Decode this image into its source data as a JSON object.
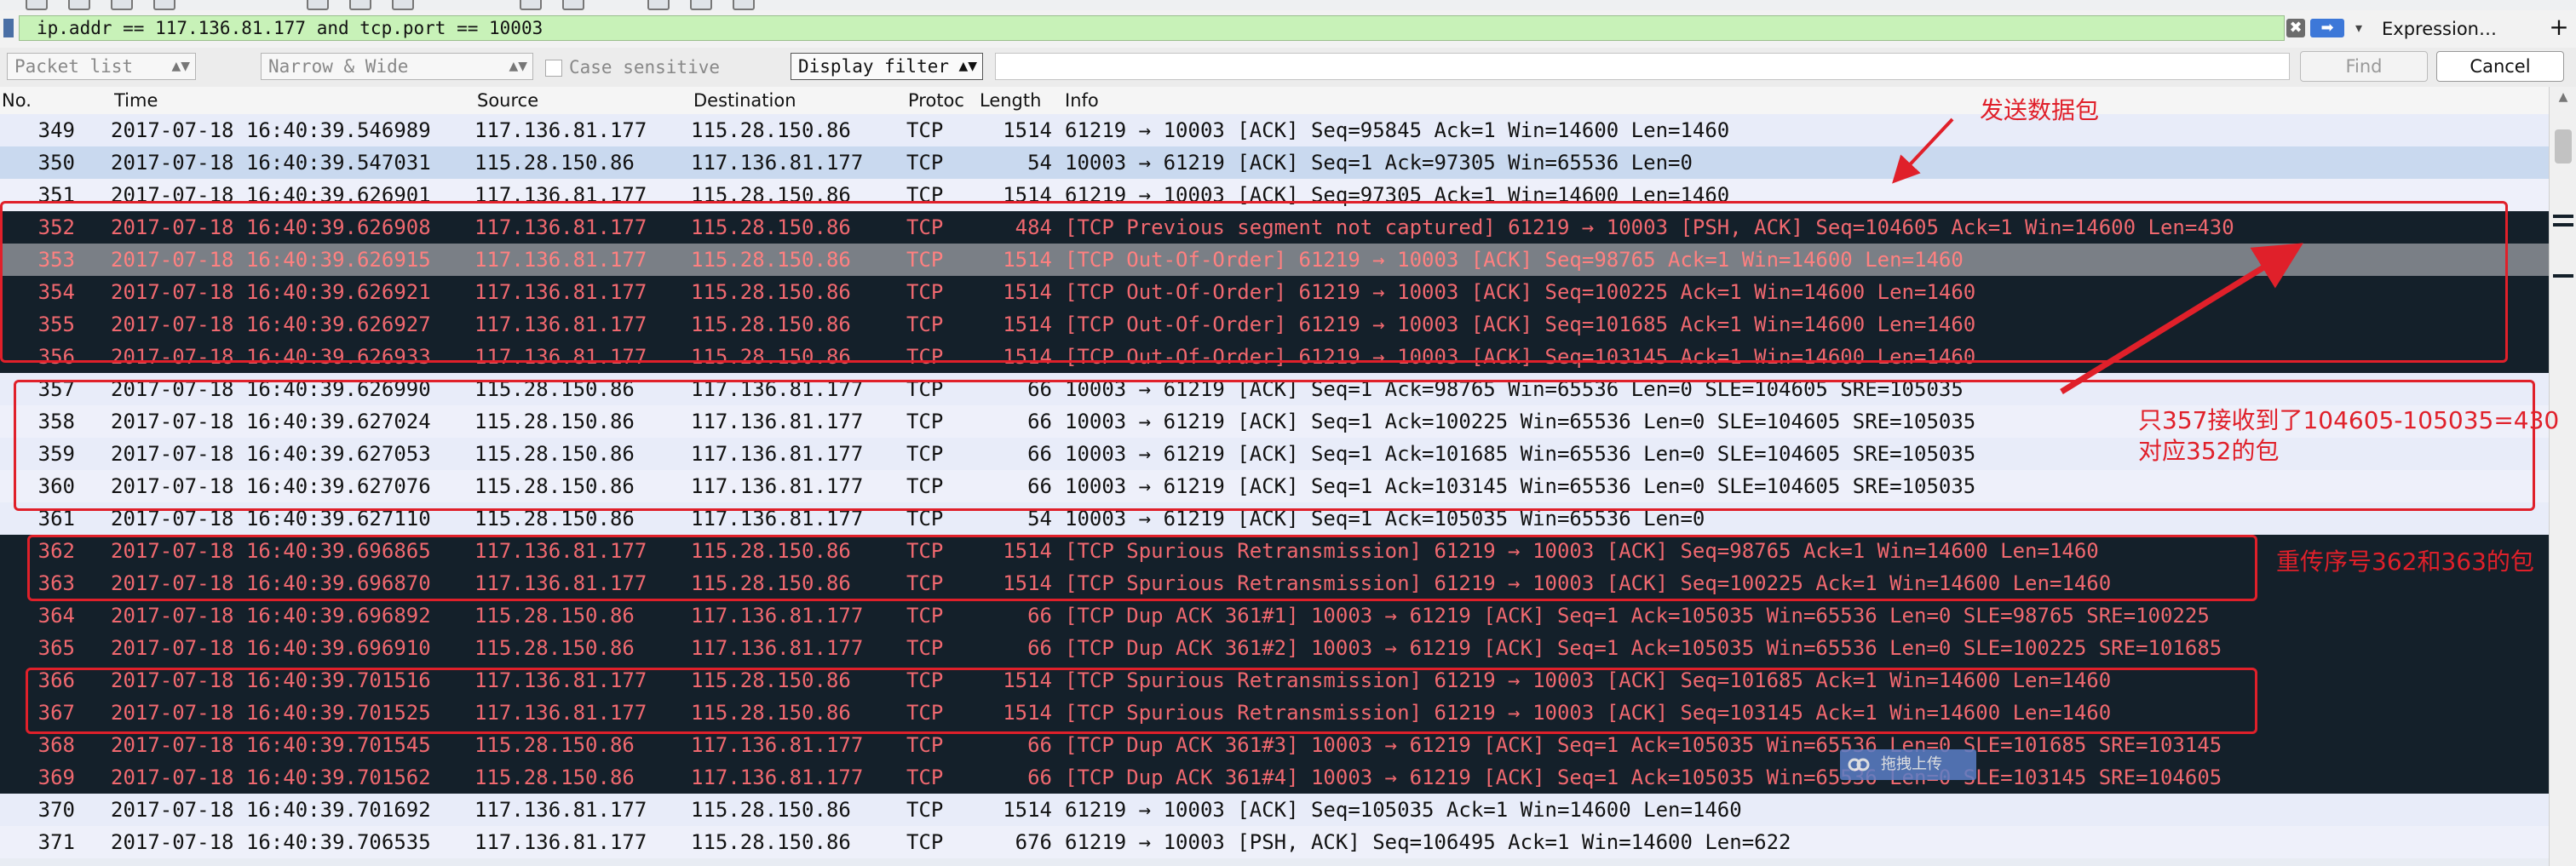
{
  "filter_bar": {
    "filter_value": "ip.addr == 117.136.81.177 and tcp.port == 10003",
    "clear_glyph": "✖",
    "apply_glyph": "➡",
    "history_glyph": "▾",
    "expression_label": "Expression…",
    "add_glyph": "+"
  },
  "search_bar": {
    "scope_combo": "Packet list",
    "charset_combo": "Narrow & Wide",
    "case_sensitive_label": "Case sensitive",
    "mode_combo": "Display filter",
    "find_label": "Find",
    "cancel_label": "Cancel"
  },
  "columns": [
    "No.",
    "Time",
    "Source",
    "Destination",
    "Protoc",
    "Length",
    "Info"
  ],
  "packets": [
    {
      "no": "349",
      "time": "2017-07-18 16:40:39.546989",
      "src": "117.136.81.177",
      "dst": "115.28.150.86",
      "proto": "TCP",
      "len": "1514",
      "info": "61219 → 10003 [ACK] Seq=95845 Ack=1 Win=14600 Len=1460",
      "style": "light"
    },
    {
      "no": "350",
      "time": "2017-07-18 16:40:39.547031",
      "src": "115.28.150.86",
      "dst": "117.136.81.177",
      "proto": "TCP",
      "len": "54",
      "info": "10003 → 61219 [ACK] Seq=1 Ack=97305 Win=65536 Len=0",
      "style": "selected"
    },
    {
      "no": "351",
      "time": "2017-07-18 16:40:39.626901",
      "src": "117.136.81.177",
      "dst": "115.28.150.86",
      "proto": "TCP",
      "len": "1514",
      "info": "61219 → 10003 [ACK] Seq=97305 Ack=1 Win=14600 Len=1460",
      "style": "light-alt"
    },
    {
      "no": "352",
      "time": "2017-07-18 16:40:39.626908",
      "src": "117.136.81.177",
      "dst": "115.28.150.86",
      "proto": "TCP",
      "len": "484",
      "info": "[TCP Previous segment not captured] 61219 → 10003 [PSH, ACK] Seq=104605 Ack=1 Win=14600 Len=430",
      "style": "dark"
    },
    {
      "no": "353",
      "time": "2017-07-18 16:40:39.626915",
      "src": "117.136.81.177",
      "dst": "115.28.150.86",
      "proto": "TCP",
      "len": "1514",
      "info": "[TCP Out-Of-Order] 61219 → 10003 [ACK] Seq=98765 Ack=1 Win=14600 Len=1460",
      "style": "darkgray"
    },
    {
      "no": "354",
      "time": "2017-07-18 16:40:39.626921",
      "src": "117.136.81.177",
      "dst": "115.28.150.86",
      "proto": "TCP",
      "len": "1514",
      "info": "[TCP Out-Of-Order] 61219 → 10003 [ACK] Seq=100225 Ack=1 Win=14600 Len=1460",
      "style": "dark"
    },
    {
      "no": "355",
      "time": "2017-07-18 16:40:39.626927",
      "src": "117.136.81.177",
      "dst": "115.28.150.86",
      "proto": "TCP",
      "len": "1514",
      "info": "[TCP Out-Of-Order] 61219 → 10003 [ACK] Seq=101685 Ack=1 Win=14600 Len=1460",
      "style": "dark"
    },
    {
      "no": "356",
      "time": "2017-07-18 16:40:39.626933",
      "src": "117.136.81.177",
      "dst": "115.28.150.86",
      "proto": "TCP",
      "len": "1514",
      "info": "[TCP Out-Of-Order] 61219 → 10003 [ACK] Seq=103145 Ack=1 Win=14600 Len=1460",
      "style": "dark"
    },
    {
      "no": "357",
      "time": "2017-07-18 16:40:39.626990",
      "src": "115.28.150.86",
      "dst": "117.136.81.177",
      "proto": "TCP",
      "len": "66",
      "info": "10003 → 61219 [ACK] Seq=1 Ack=98765 Win=65536 Len=0 SLE=104605 SRE=105035",
      "style": "light"
    },
    {
      "no": "358",
      "time": "2017-07-18 16:40:39.627024",
      "src": "115.28.150.86",
      "dst": "117.136.81.177",
      "proto": "TCP",
      "len": "66",
      "info": "10003 → 61219 [ACK] Seq=1 Ack=100225 Win=65536 Len=0 SLE=104605 SRE=105035",
      "style": "light-alt"
    },
    {
      "no": "359",
      "time": "2017-07-18 16:40:39.627053",
      "src": "115.28.150.86",
      "dst": "117.136.81.177",
      "proto": "TCP",
      "len": "66",
      "info": "10003 → 61219 [ACK] Seq=1 Ack=101685 Win=65536 Len=0 SLE=104605 SRE=105035",
      "style": "light"
    },
    {
      "no": "360",
      "time": "2017-07-18 16:40:39.627076",
      "src": "115.28.150.86",
      "dst": "117.136.81.177",
      "proto": "TCP",
      "len": "66",
      "info": "10003 → 61219 [ACK] Seq=1 Ack=103145 Win=65536 Len=0 SLE=104605 SRE=105035",
      "style": "light-alt"
    },
    {
      "no": "361",
      "time": "2017-07-18 16:40:39.627110",
      "src": "115.28.150.86",
      "dst": "117.136.81.177",
      "proto": "TCP",
      "len": "54",
      "info": "10003 → 61219 [ACK] Seq=1 Ack=105035 Win=65536 Len=0",
      "style": "light"
    },
    {
      "no": "362",
      "time": "2017-07-18 16:40:39.696865",
      "src": "117.136.81.177",
      "dst": "115.28.150.86",
      "proto": "TCP",
      "len": "1514",
      "info": "[TCP Spurious Retransmission] 61219 → 10003 [ACK] Seq=98765 Ack=1 Win=14600 Len=1460",
      "style": "dark"
    },
    {
      "no": "363",
      "time": "2017-07-18 16:40:39.696870",
      "src": "117.136.81.177",
      "dst": "115.28.150.86",
      "proto": "TCP",
      "len": "1514",
      "info": "[TCP Spurious Retransmission] 61219 → 10003 [ACK] Seq=100225 Ack=1 Win=14600 Len=1460",
      "style": "dark"
    },
    {
      "no": "364",
      "time": "2017-07-18 16:40:39.696892",
      "src": "115.28.150.86",
      "dst": "117.136.81.177",
      "proto": "TCP",
      "len": "66",
      "info": "[TCP Dup ACK 361#1] 10003 → 61219 [ACK] Seq=1 Ack=105035 Win=65536 Len=0 SLE=98765 SRE=100225",
      "style": "dark"
    },
    {
      "no": "365",
      "time": "2017-07-18 16:40:39.696910",
      "src": "115.28.150.86",
      "dst": "117.136.81.177",
      "proto": "TCP",
      "len": "66",
      "info": "[TCP Dup ACK 361#2] 10003 → 61219 [ACK] Seq=1 Ack=105035 Win=65536 Len=0 SLE=100225 SRE=101685",
      "style": "dark"
    },
    {
      "no": "366",
      "time": "2017-07-18 16:40:39.701516",
      "src": "117.136.81.177",
      "dst": "115.28.150.86",
      "proto": "TCP",
      "len": "1514",
      "info": "[TCP Spurious Retransmission] 61219 → 10003 [ACK] Seq=101685 Ack=1 Win=14600 Len=1460",
      "style": "dark"
    },
    {
      "no": "367",
      "time": "2017-07-18 16:40:39.701525",
      "src": "117.136.81.177",
      "dst": "115.28.150.86",
      "proto": "TCP",
      "len": "1514",
      "info": "[TCP Spurious Retransmission] 61219 → 10003 [ACK] Seq=103145 Ack=1 Win=14600 Len=1460",
      "style": "dark"
    },
    {
      "no": "368",
      "time": "2017-07-18 16:40:39.701545",
      "src": "115.28.150.86",
      "dst": "117.136.81.177",
      "proto": "TCP",
      "len": "66",
      "info": "[TCP Dup ACK 361#3] 10003 → 61219 [ACK] Seq=1 Ack=105035 Win=65536 Len=0 SLE=101685 SRE=103145",
      "style": "dark"
    },
    {
      "no": "369",
      "time": "2017-07-18 16:40:39.701562",
      "src": "115.28.150.86",
      "dst": "117.136.81.177",
      "proto": "TCP",
      "len": "66",
      "info": "[TCP Dup ACK 361#4] 10003 → 61219 [ACK] Seq=1 Ack=105035 Win=65536 Len=0 SLE=103145 SRE=104605",
      "style": "dark"
    },
    {
      "no": "370",
      "time": "2017-07-18 16:40:39.701692",
      "src": "117.136.81.177",
      "dst": "115.28.150.86",
      "proto": "TCP",
      "len": "1514",
      "info": "61219 → 10003 [ACK] Seq=105035 Ack=1 Win=14600 Len=1460",
      "style": "light"
    },
    {
      "no": "371",
      "time": "2017-07-18 16:40:39.706535",
      "src": "117.136.81.177",
      "dst": "115.28.150.86",
      "proto": "TCP",
      "len": "676",
      "info": "61219 → 10003 [PSH, ACK] Seq=106495 Ack=1 Win=14600 Len=622",
      "style": "light-alt"
    }
  ],
  "annotations": {
    "send_packets": "发送数据包",
    "only_357": "只357接收到了104605-105035=430",
    "matches_352": "对应352的包",
    "retransmit": "重传序号362和363的包"
  },
  "watermark_text": "拖拽上传",
  "colors": {
    "filter_valid_bg": "#c8f2b8",
    "annotation_red": "#e0202a",
    "dark_row_bg": "#14202a",
    "dark_row_text": "#f0686f",
    "light_row_bg": "#e8ecf9",
    "selected_row_bg": "#c9d9ef"
  }
}
